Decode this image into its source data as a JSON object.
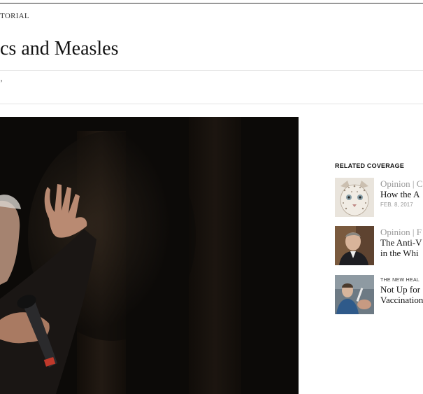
{
  "article": {
    "kicker": "TORIAL",
    "headline": "cs and Measles",
    "byline_fragment": "’"
  },
  "related": {
    "title": "RELATED COVERAGE",
    "items": [
      {
        "section": "Opinion | C",
        "title_lines": [
          "How the A"
        ],
        "date": "FEB. 8, 2017",
        "thumb_icon": "leopard-face-illustration"
      },
      {
        "section": "Opinion | F",
        "title_lines": [
          "The Anti-V",
          "in the Whi"
        ],
        "date": "",
        "thumb_icon": "man-portrait-photo"
      },
      {
        "section": "THE NEW HEAL",
        "title_lines": [
          "Not Up for",
          "Vaccination"
        ],
        "date": "",
        "thumb_icon": "vaccination-photo"
      }
    ]
  }
}
